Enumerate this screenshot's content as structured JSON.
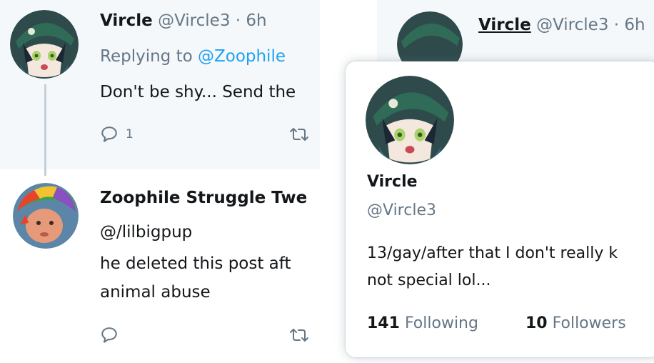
{
  "left_tweet": {
    "author_name": "Vircle",
    "author_handle_time": "@Vircle3 · 6h",
    "replying_prefix": "Replying to ",
    "replying_handle": "@Zoophile",
    "body": "Don't be shy... Send the",
    "reply_count": "1"
  },
  "left_reply": {
    "author_name": "Zoophile Struggle Twe",
    "author_handle": "@/lilbigpup",
    "body_line1": "he deleted this post aft",
    "body_line2": "animal abuse"
  },
  "right_header": {
    "author_name": "Vircle",
    "author_handle_time": "@Vircle3 · 6h"
  },
  "hovercard": {
    "name": "Vircle",
    "handle": "@Vircle3",
    "bio_line1": "13/gay/after that I don't really k",
    "bio_line2": "not special lol...",
    "following_count": "141",
    "following_label": "Following",
    "followers_count": "10",
    "followers_label": "Followers"
  },
  "icons": {
    "reply": "reply-icon",
    "retweet": "retweet-icon"
  },
  "colors": {
    "muted": "#657786",
    "link": "#1da1f2",
    "bg_gray": "#f5f8fa"
  }
}
